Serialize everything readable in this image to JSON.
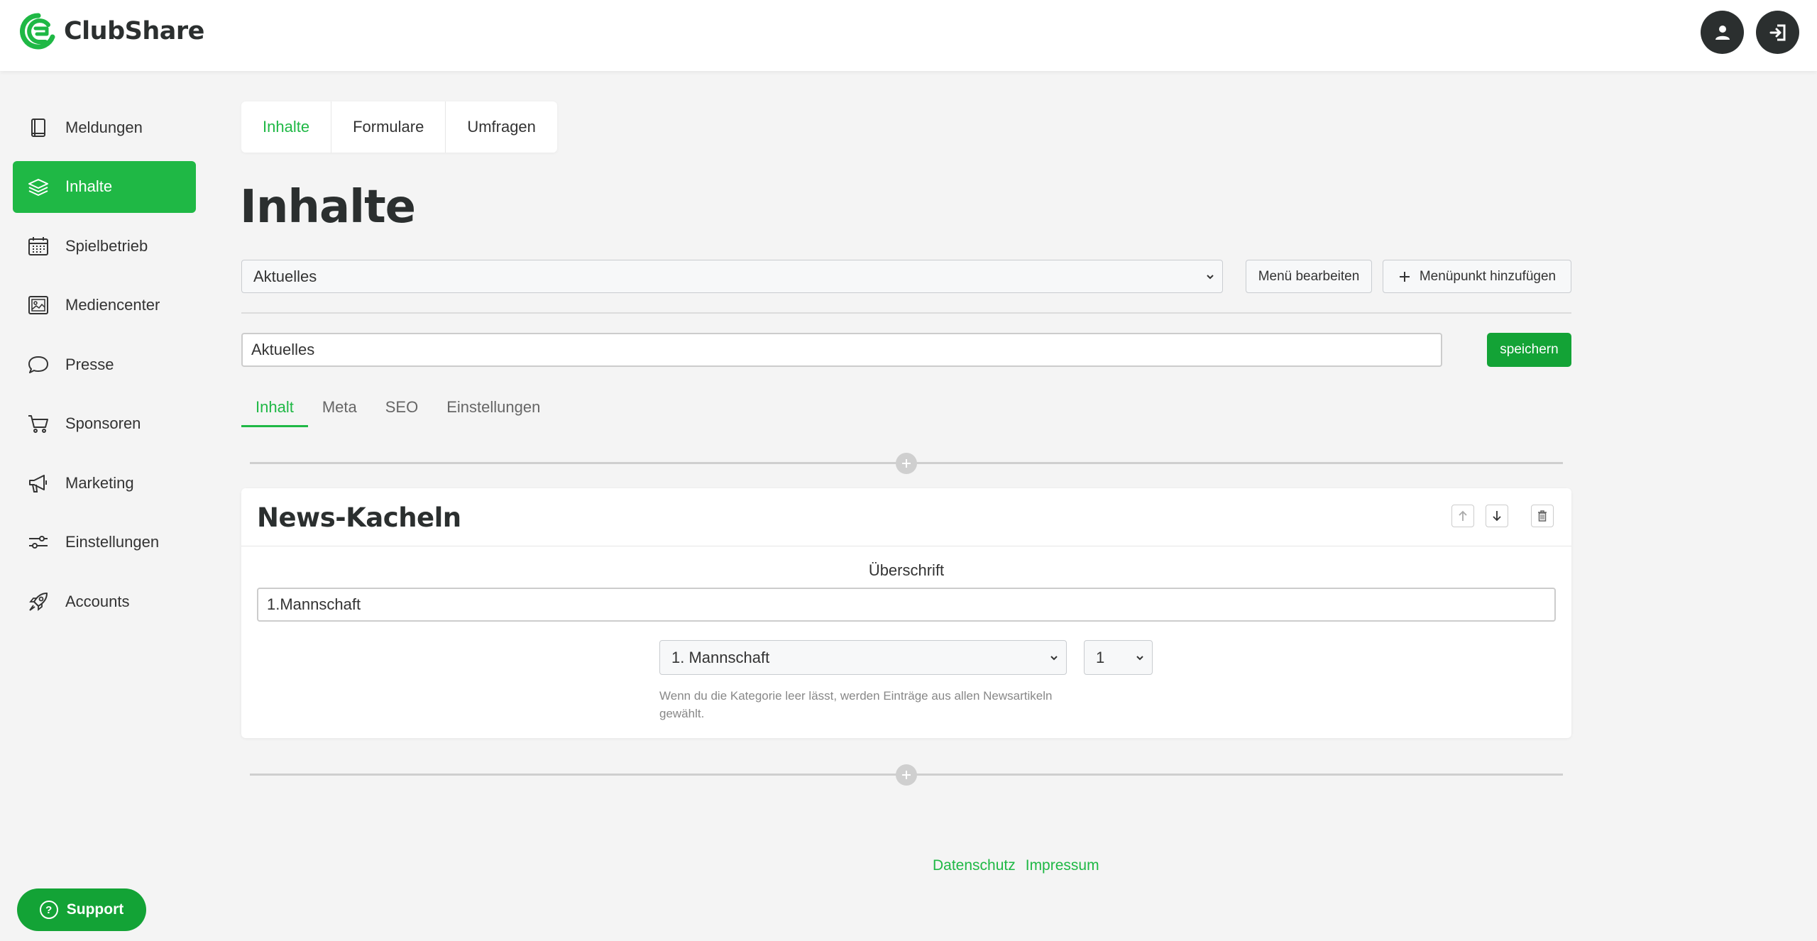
{
  "app": {
    "name": "ClubShare"
  },
  "header": {
    "user_icon": "user-icon",
    "logout_icon": "logout-icon"
  },
  "sidebar": {
    "items": [
      {
        "label": "Meldungen",
        "icon": "book-icon",
        "active": false
      },
      {
        "label": "Inhalte",
        "icon": "layers-icon",
        "active": true
      },
      {
        "label": "Spielbetrieb",
        "icon": "calendar-icon",
        "active": false
      },
      {
        "label": "Mediencenter",
        "icon": "image-icon",
        "active": false
      },
      {
        "label": "Presse",
        "icon": "chat-icon",
        "active": false
      },
      {
        "label": "Sponsoren",
        "icon": "cart-icon",
        "active": false
      },
      {
        "label": "Marketing",
        "icon": "megaphone-icon",
        "active": false
      },
      {
        "label": "Einstellungen",
        "icon": "sliders-icon",
        "active": false
      },
      {
        "label": "Accounts",
        "icon": "rocket-icon",
        "active": false
      }
    ]
  },
  "top_tabs": [
    {
      "label": "Inhalte",
      "active": true
    },
    {
      "label": "Formulare",
      "active": false
    },
    {
      "label": "Umfragen",
      "active": false
    }
  ],
  "page": {
    "title": "Inhalte",
    "menu_select": "Aktuelles",
    "edit_menu_label": "Menü bearbeiten",
    "add_item_label": "Menüpunkt hinzufügen",
    "title_input": "Aktuelles",
    "save_label": "speichern"
  },
  "sub_tabs": [
    {
      "label": "Inhalt",
      "active": true
    },
    {
      "label": "Meta",
      "active": false
    },
    {
      "label": "SEO",
      "active": false
    },
    {
      "label": "Einstellungen",
      "active": false
    }
  ],
  "block": {
    "title": "News-Kacheln",
    "heading_label": "Überschrift",
    "heading_value": "1.Mannschaft",
    "category_select": "1. Mannschaft",
    "count_select": "1",
    "hint": "Wenn du die Kategorie leer lässt, werden Einträge aus allen Newsartikeln gewählt."
  },
  "footer": {
    "privacy": "Datenschutz",
    "imprint": "Impressum"
  },
  "support": {
    "label": "Support"
  },
  "colors": {
    "accent": "#1fb845",
    "accent_dark": "#13a336",
    "dark": "#2b2f2f",
    "background": "#f4f4f4"
  }
}
